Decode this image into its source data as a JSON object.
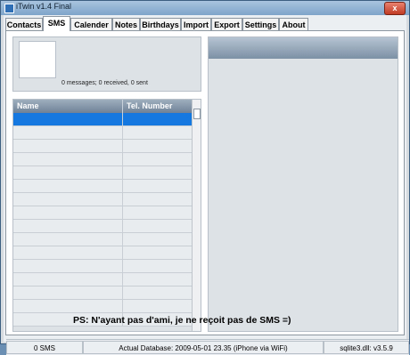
{
  "window": {
    "title": "iTwin v1.4 Final",
    "close_glyph": "x"
  },
  "tabs": [
    "Contacts",
    "SMS",
    "Calender",
    "Notes",
    "Birthdays",
    "Import",
    "Export",
    "Settings",
    "About"
  ],
  "active_tab": "SMS",
  "sms": {
    "message_summary": "0 messages; 0 received, 0 sent",
    "columns": [
      "Name",
      "Tel. Number"
    ]
  },
  "note": "PS: N'ayant pas d'ami, je ne reçoit pas de SMS =)",
  "status": {
    "sms_count": "0 SMS",
    "database": "Actual Database: 2009-05-01  23.35  (iPhone via WiFi)",
    "sqlite": "sqlite3.dll: v3.5.9"
  }
}
